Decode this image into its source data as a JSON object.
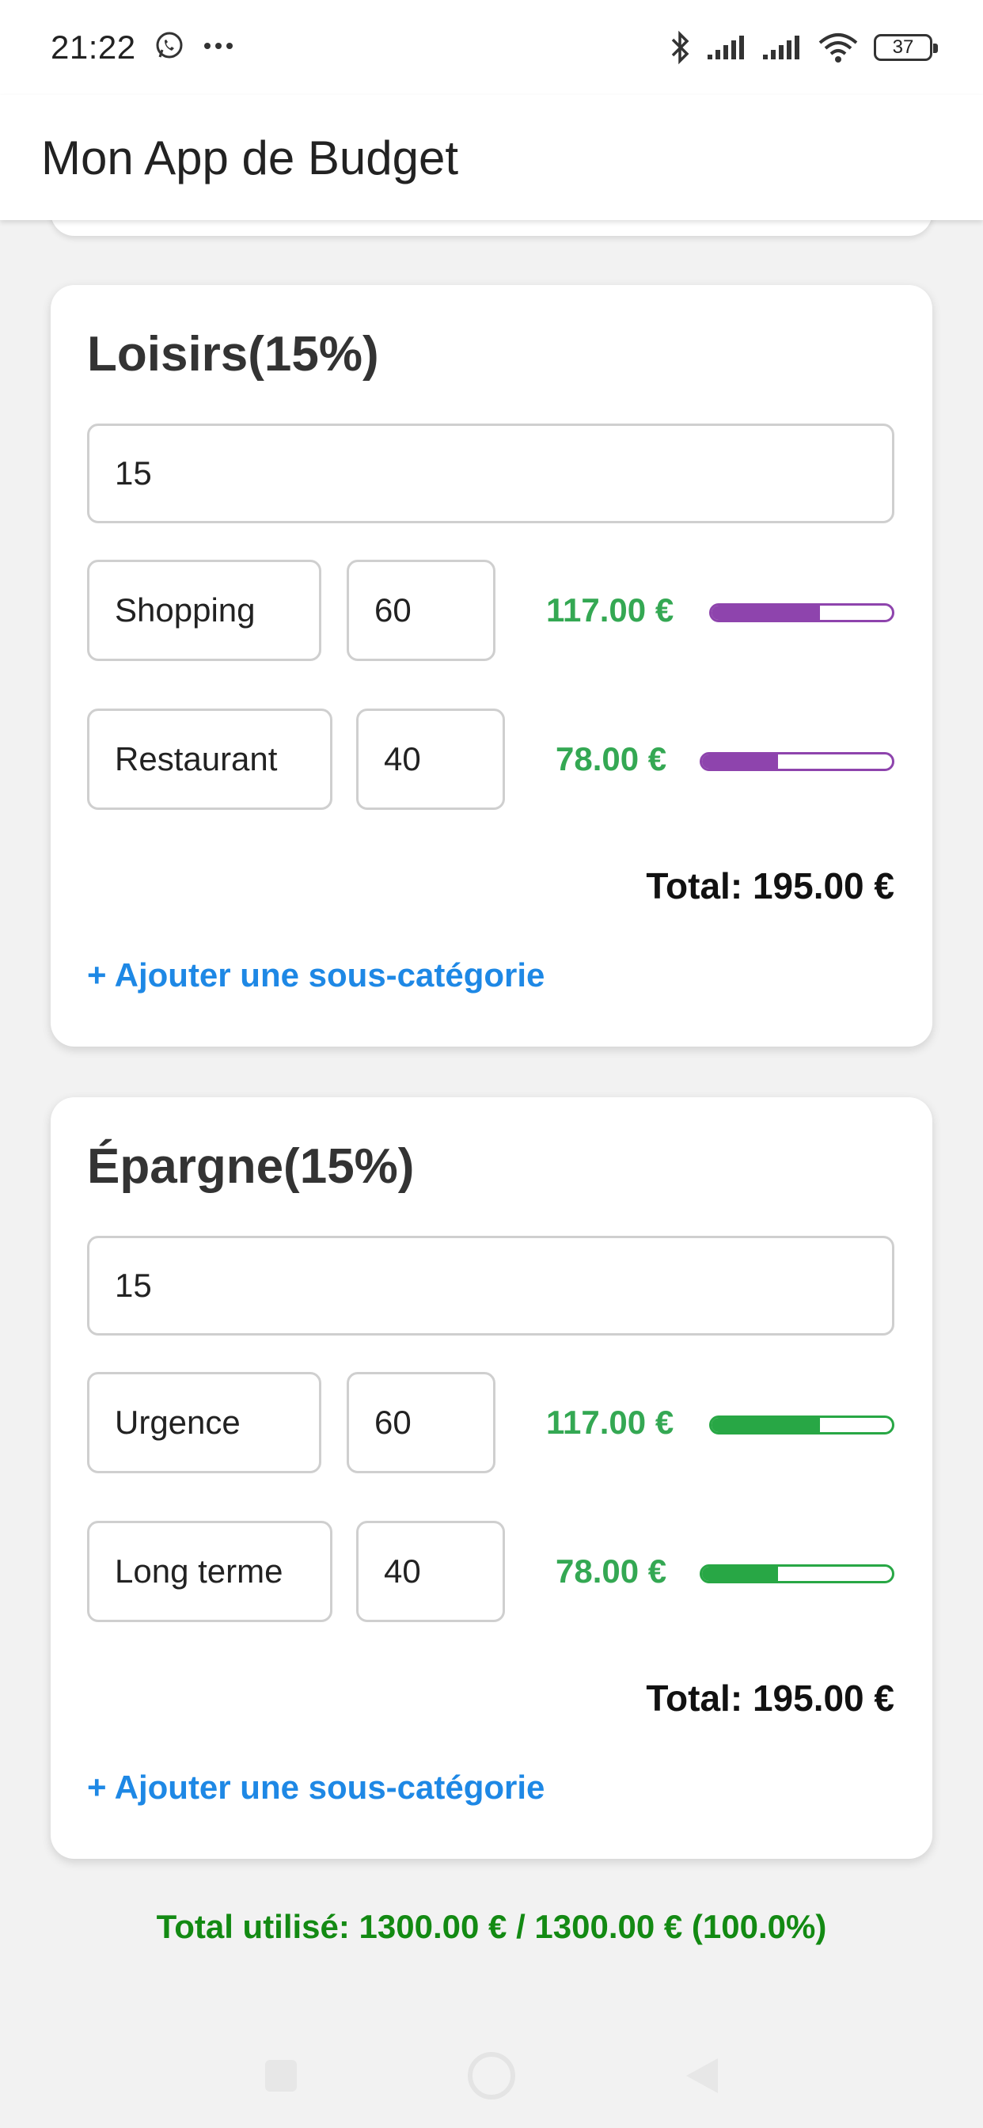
{
  "status_bar": {
    "time": "21:22",
    "battery": "37",
    "icons": [
      "whatsapp-icon",
      "more-dots-icon",
      "bluetooth-icon",
      "signal-icon",
      "signal-icon",
      "wifi-icon",
      "battery-icon"
    ]
  },
  "app_bar": {
    "title": "Mon App de Budget"
  },
  "categories": [
    {
      "title": "Loisirs(15%)",
      "percent_value": "15",
      "subcategories": [
        {
          "name": "Shopping",
          "percent": "60",
          "amount": "117.00 €",
          "progress": 0.6,
          "bar_color": "#8e44ad"
        },
        {
          "name": "Restaurant",
          "percent": "40",
          "amount": "78.00 €",
          "progress": 0.4,
          "bar_color": "#8e44ad"
        }
      ],
      "total": "Total: 195.00 €",
      "add_label": "+ Ajouter une sous-catégorie"
    },
    {
      "title": "Épargne(15%)",
      "percent_value": "15",
      "subcategories": [
        {
          "name": "Urgence",
          "percent": "60",
          "amount": "117.00 €",
          "progress": 0.6,
          "bar_color": "#28a745"
        },
        {
          "name": "Long terme",
          "percent": "40",
          "amount": "78.00 €",
          "progress": 0.4,
          "bar_color": "#28a745"
        }
      ],
      "total": "Total: 195.00 €",
      "add_label": "+ Ajouter une sous-catégorie"
    }
  ],
  "footer": {
    "total_used": "Total utilisé: 1300.00 € / 1300.00 € (100.0%)"
  },
  "colors": {
    "amount_green": "#34a853",
    "link_blue": "#1e88e5",
    "total_used_green": "#138a13",
    "purple_bar": "#8e44ad",
    "green_bar": "#28a745"
  }
}
